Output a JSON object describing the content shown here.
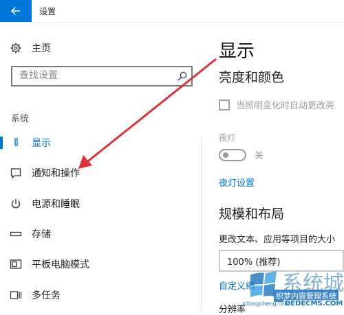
{
  "window": {
    "title": "设置",
    "back_icon": "arrow-left-icon"
  },
  "nav": {
    "home_label": "主页",
    "search_placeholder": "查找设置",
    "section_label": "系统",
    "items": [
      {
        "label": "显示",
        "icon": "monitor-icon",
        "active": true
      },
      {
        "label": "通知和操作",
        "icon": "notification-icon",
        "active": false
      },
      {
        "label": "电源和睡眠",
        "icon": "power-icon",
        "active": false
      },
      {
        "label": "存储",
        "icon": "storage-icon",
        "active": false
      },
      {
        "label": "平板电脑模式",
        "icon": "tablet-mode-icon",
        "active": false
      },
      {
        "label": "多任务",
        "icon": "multitask-icon",
        "active": false
      }
    ]
  },
  "content": {
    "page_title": "显示",
    "brightness_heading": "亮度和颜色",
    "auto_brightness_label": "当照明变化时自动更改亮",
    "night_light_label": "夜灯",
    "night_light_state": "关",
    "night_light_settings_link": "夜灯设置",
    "scale_heading": "规模和布局",
    "scale_description": "更改文本、应用等项目的大小",
    "scale_value": "100% (推荐)",
    "custom_scaling_link": "自定义缩",
    "resolution_label": "分辨率"
  },
  "watermark": {
    "brand_big": "系统城",
    "line1": "织梦内容管理系统",
    "line2": "DEDECMS.COM",
    "line3": "xitongcheng.com"
  },
  "colors": {
    "accent": "#0078d7",
    "annotation_arrow": "#d9343a"
  }
}
